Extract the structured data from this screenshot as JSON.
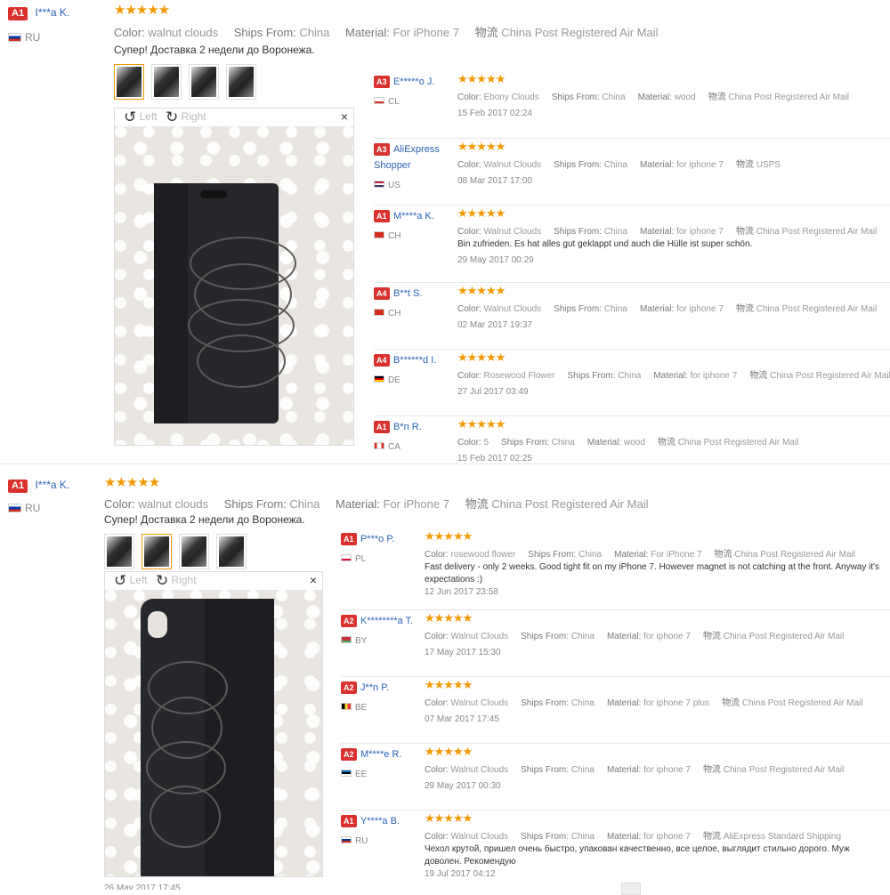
{
  "review1": {
    "badge": "A1",
    "name": "I***a K.",
    "country": "RU",
    "stars": "★★★★★",
    "color_label": "Color:",
    "color": "walnut clouds",
    "ships_label": "Ships From:",
    "ships": "China",
    "material_label": "Material:",
    "material": "For iPhone 7",
    "logistics_label": "物流",
    "logistics": "China Post Registered Air Mail",
    "text": "Супер! Доставка 2 недели до Воронежа.",
    "viewer": {
      "left": "Left",
      "right": "Right",
      "close": "×"
    }
  },
  "review2": {
    "badge": "A1",
    "name": "I***a K.",
    "country": "RU",
    "stars": "★★★★★",
    "color_label": "Color:",
    "color": "walnut clouds",
    "ships_label": "Ships From:",
    "ships": "China",
    "material_label": "Material:",
    "material": "For iPhone 7",
    "logistics_label": "物流",
    "logistics": "China Post Registered Air Mail",
    "text": "Супер! Доставка 2 недели до Воронежа.",
    "viewer": {
      "left": "Left",
      "right": "Right",
      "close": "×"
    },
    "partial_date": "26 May 2017 17:45"
  },
  "list1": [
    {
      "badge": "A3",
      "name": "E*****o J.",
      "country": "CL",
      "stars": "★★★★★",
      "color": "Ebony Clouds",
      "ships": "China",
      "material": "wood",
      "logistics": "China Post Registered Air Mail",
      "text": "",
      "date": "15 Feb 2017 02:24"
    },
    {
      "badge": "A3",
      "name": "AliExpress Shopper",
      "country": "US",
      "stars": "★★★★★",
      "color": "Walnut Clouds",
      "ships": "China",
      "material": "for iphone 7",
      "logistics": "USPS",
      "text": "",
      "date": "08 Mar 2017 17:00"
    },
    {
      "badge": "A1",
      "name": "M****a K.",
      "country": "CH",
      "stars": "★★★★★",
      "color": "Walnut Clouds",
      "ships": "China",
      "material": "for iphone 7",
      "logistics": "China Post Registered Air Mail",
      "text": "Bin zufrieden. Es hat alles gut geklappt und auch die Hülle ist super schön.",
      "date": "29 May 2017 00:29"
    },
    {
      "badge": "A4",
      "name": "B**t S.",
      "country": "CH",
      "stars": "★★★★★",
      "color": "Walnut Clouds",
      "ships": "China",
      "material": "for iphone 7",
      "logistics": "China Post Registered Air Mail",
      "text": "",
      "date": "02 Mar 2017 19:37"
    },
    {
      "badge": "A4",
      "name": "B******d I.",
      "country": "DE",
      "stars": "★★★★★",
      "color": "Rosewood Flower",
      "ships": "China",
      "material": "for iphone 7",
      "logistics": "China Post Registered Air Mail",
      "text": "",
      "date": "27 Jul 2017 03:49"
    },
    {
      "badge": "A1",
      "name": "B*n R.",
      "country": "CA",
      "stars": "★★★★★",
      "color": "5",
      "ships": "China",
      "material": "wood",
      "logistics": "China Post Registered Air Mail",
      "text": "",
      "date": "15 Feb 2017 02:25"
    }
  ],
  "list2": [
    {
      "badge": "A1",
      "name": "P***o P.",
      "country": "PL",
      "stars": "★★★★★",
      "color": "rosewood flower",
      "ships": "China",
      "material": "For iPhone 7",
      "logistics": "China Post Registered Air Mail",
      "text": "Fast delivery - only 2 weeks. Good tight fit on my iPhone 7. However magnet is not catching at the front. Anyway it's expectations :)",
      "date": "12 Jun 2017 23:58"
    },
    {
      "badge": "A2",
      "name": "K********a T.",
      "country": "BY",
      "stars": "★★★★★",
      "color": "Walnut Clouds",
      "ships": "China",
      "material": "for iphone 7",
      "logistics": "China Post Registered Air Mail",
      "text": "",
      "date": "17 May 2017 15:30"
    },
    {
      "badge": "A2",
      "name": "J**n P.",
      "country": "BE",
      "stars": "★★★★★",
      "color": "Walnut Clouds",
      "ships": "China",
      "material": "for iphone 7 plus",
      "logistics": "China Post Registered Air Mail",
      "text": "",
      "date": "07 Mar 2017 17:45"
    },
    {
      "badge": "A2",
      "name": "M****e R.",
      "country": "EE",
      "stars": "★★★★★",
      "color": "Walnut Clouds",
      "ships": "China",
      "material": "for iphone 7",
      "logistics": "China Post Registered Air Mail",
      "text": "",
      "date": "29 May 2017 00:30"
    },
    {
      "badge": "A1",
      "name": "Y****a B.",
      "country": "RU",
      "stars": "★★★★★",
      "color": "Walnut Clouds",
      "ships": "China",
      "material": "for iphone 7",
      "logistics": "AliExpress Standard Shipping",
      "text": "Чехол крутой, пришел очень быстро, упакован качественно, все целое, выглядит стильно дорого. Муж доволен. Рекомендую",
      "date": "19 Jul 2017 04:12"
    }
  ],
  "labels": {
    "color": "Color:",
    "ships": "Ships From:",
    "material": "Material:",
    "logistics": "物流"
  },
  "colors": {
    "accent": "#f39800",
    "badge": "#d9322e",
    "link": "#2a62b6"
  },
  "flags": {
    "RU": [
      "#fff",
      "#0039a6",
      "#d52b1e"
    ],
    "CL": [
      "#fff",
      "#fff",
      "#d52b1e"
    ],
    "US": [
      "#b22234",
      "#fff",
      "#3c3b6e"
    ],
    "CH": [
      "#d52b1e",
      "#d52b1e",
      "#d52b1e"
    ],
    "DE": [
      "#000",
      "#dd0000",
      "#ffce00"
    ],
    "CA": [
      "#d52b1e",
      "#fff",
      "#d52b1e"
    ],
    "PL": [
      "#fff",
      "#fff",
      "#dc143c"
    ],
    "BY": [
      "#c8313e",
      "#c8313e",
      "#4aa657"
    ],
    "BE": [
      "#000",
      "#fdda24",
      "#ef3340"
    ],
    "EE": [
      "#0072ce",
      "#000",
      "#fff"
    ]
  }
}
